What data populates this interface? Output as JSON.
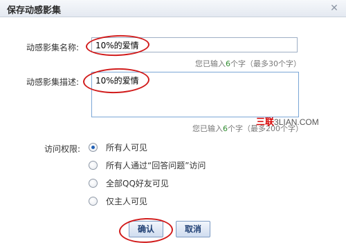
{
  "dialog": {
    "title": "保存动感影集",
    "close_glyph": "✕"
  },
  "form": {
    "name_label": "动感影集名称:",
    "name_value": "10%的爱情",
    "name_hint_prefix": "您已输入",
    "name_hint_count": "6",
    "name_hint_suffix": "个字（最多30个字）",
    "desc_label": "动感影集描述:",
    "desc_value": "10%的爱情",
    "desc_hint_prefix": "您已输入",
    "desc_hint_count": "6",
    "desc_hint_suffix": "个字（最多200个字）",
    "access_label": "访问权限:",
    "access_options": [
      {
        "label": "所有人可见",
        "checked": true
      },
      {
        "label": "所有人通过“回答问题”访问",
        "checked": false
      },
      {
        "label": "全部QQ好友可见",
        "checked": false
      },
      {
        "label": "仅主人可见",
        "checked": false
      }
    ]
  },
  "buttons": {
    "confirm_label": "确认",
    "cancel_label": "取消"
  },
  "watermark": {
    "cn": "三联",
    "en": "3LIAN.COM"
  },
  "colors": {
    "annotation_ring": "#d11b1b",
    "accent_blue": "#1f5fb5",
    "count_green": "#2e8b2e"
  }
}
